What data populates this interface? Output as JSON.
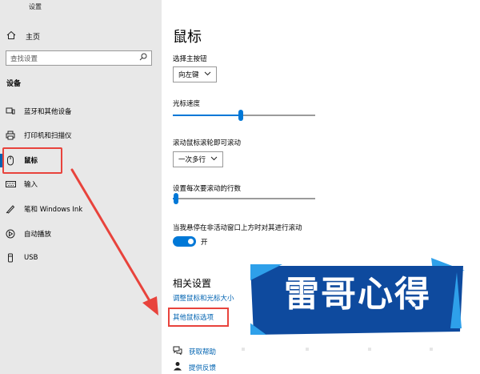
{
  "window": {
    "title": "设置"
  },
  "sidebar": {
    "home": "主页",
    "search_placeholder": "查找设置",
    "section": "设备",
    "items": [
      {
        "label": "蓝牙和其他设备",
        "icon": "bluetooth-icon"
      },
      {
        "label": "打印机和扫描仪",
        "icon": "printer-icon"
      },
      {
        "label": "鼠标",
        "icon": "mouse-icon"
      },
      {
        "label": "输入",
        "icon": "keyboard-icon"
      },
      {
        "label": "笔和 Windows Ink",
        "icon": "pen-icon"
      },
      {
        "label": "自动播放",
        "icon": "autoplay-icon"
      },
      {
        "label": "USB",
        "icon": "usb-icon"
      }
    ]
  },
  "main": {
    "title": "鼠标",
    "primary_button": {
      "label": "选择主按钮",
      "value": "向左键"
    },
    "cursor_speed": {
      "label": "光标速度",
      "value_fraction": 0.48
    },
    "wheel_scroll": {
      "label": "滚动鼠标滚轮即可滚动",
      "value": "一次多行"
    },
    "lines_per_scroll": {
      "label": "设置每次要滚动的行数",
      "value_fraction": 0.02
    },
    "inactive_scroll": {
      "label": "当我悬停在非活动窗口上方时对其进行滚动",
      "state": "开"
    },
    "related": {
      "title": "相关设置",
      "links": [
        "调整鼠标和光标大小",
        "其他鼠标选项"
      ]
    },
    "help": [
      "获取帮助",
      "提供反馈"
    ]
  },
  "stamp": {
    "text": "雷哥心得"
  },
  "colors": {
    "accent": "#0078d7",
    "highlight": "#e8433c",
    "stamp_blue": "#0e4a9e",
    "stamp_light": "#2ea0ea"
  }
}
